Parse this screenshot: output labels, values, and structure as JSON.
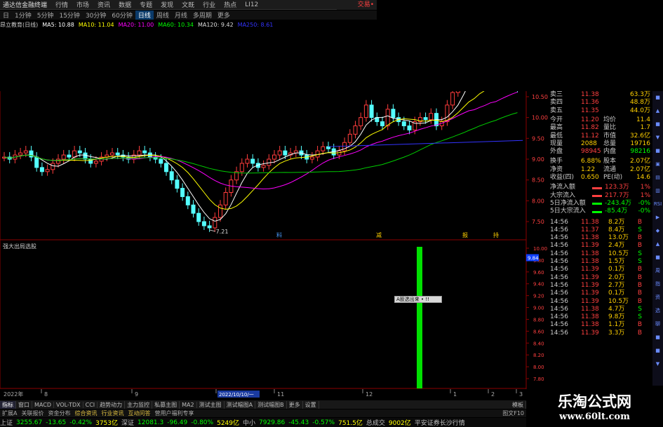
{
  "app": {
    "title": "通达信金融终端",
    "top_right": "交易•"
  },
  "menu": [
    "行情",
    "市场",
    "资讯",
    "数据",
    "专题",
    "发现",
    "文既",
    "行业",
    "热点",
    "LI12"
  ],
  "periods": [
    "日",
    "1分钟",
    "5分钟",
    "15分钟",
    "30分钟",
    "60分钟",
    "日线",
    "周线",
    "月线",
    "多周期",
    "更多"
  ],
  "active_period": "日线",
  "stock_label": "昂立教育(日线)",
  "ma": [
    {
      "label": "MA5: 10.88",
      "color": "#ffffff"
    },
    {
      "label": "MA10: 11.04",
      "color": "#ffff00"
    },
    {
      "label": "MA20: 11.00",
      "color": "#ff00ff"
    },
    {
      "label": "MA60: 10.34",
      "color": "#00ff00"
    },
    {
      "label": "MA120: 9.42",
      "color": "#dddddd"
    },
    {
      "label": "MA250: 8.61",
      "color": "#3333ff"
    }
  ],
  "price_axis": [
    "10.50",
    "10.00",
    "9.50",
    "9.00",
    "8.50",
    "8.00",
    "7.50"
  ],
  "low_label": "7.21",
  "event_marks": [
    {
      "label": "料",
      "color": "#4a9cff"
    },
    {
      "label": "减",
      "color": "#ffd000"
    },
    {
      "label": "报",
      "color": "#ffd000"
    },
    {
      "label": "持",
      "color": "#ffd000"
    }
  ],
  "indicator_title": "强大出局选股",
  "indicator_axis": [
    "10.00",
    "9.80",
    "9.60",
    "9.40",
    "9.20",
    "9.00",
    "8.80",
    "8.60",
    "8.40",
    "8.20",
    "8.00",
    "7.80"
  ],
  "cursor_value": "9.84",
  "tooltip": "A股选出来 • !!",
  "date_axis": [
    "2022年",
    "8",
    "9",
    "10",
    "11",
    "12",
    "1",
    "2",
    "3"
  ],
  "date_highlight": "2022/10/10/一",
  "quote": {
    "ask": [
      {
        "label": "卖三",
        "price": "11.38",
        "vol": "63.3万"
      },
      {
        "label": "卖四",
        "price": "11.36",
        "vol": "48.8万"
      },
      {
        "label": "卖五",
        "price": "11.35",
        "vol": "44.0万"
      }
    ],
    "stats": [
      {
        "l1": "今开",
        "v1": "11.20",
        "c1": "#ff4040",
        "l2": "均价",
        "v2": "11.4"
      },
      {
        "l1": "最高",
        "v1": "11.82",
        "c1": "#ff4040",
        "l2": "量比",
        "v2": "1.7"
      },
      {
        "l1": "最低",
        "v1": "11.12",
        "c1": "#ff4040",
        "l2": "市值",
        "v2": "32.6亿"
      },
      {
        "l1": "现量",
        "v1": "2088",
        "c1": "#ffd000",
        "l2": "总量",
        "v2": "19716"
      },
      {
        "l1": "外盘",
        "v1": "98945",
        "c1": "#ff4040",
        "l2": "内盘",
        "v2": "98216"
      }
    ],
    "stats2": [
      {
        "l1": "换手",
        "v1": "6.88%",
        "l2": "股本",
        "v2": "2.07亿"
      },
      {
        "l1": "净资",
        "v1": "1.22",
        "l2": "流通",
        "v2": "2.07亿"
      },
      {
        "l1": "收益(四)",
        "v1": "0.650",
        "l2": "PE(动)",
        "v2": "14.6"
      }
    ],
    "flows": [
      {
        "label": "净流入额",
        "value": "123.3万",
        "pct": "1%",
        "color": "#ff4040"
      },
      {
        "label": "大宗流入",
        "value": "217.7万",
        "pct": "1%",
        "color": "#ff4040"
      },
      {
        "label": "5日净流入额",
        "value": "-243.4万",
        "pct": "-0%",
        "color": "#00ff00"
      },
      {
        "label": "5日大宗流入",
        "value": "-85.4万",
        "pct": "-0%",
        "color": "#00ff00"
      }
    ],
    "ticks": [
      {
        "t": "14:56",
        "p": "11.38",
        "v": "8.2万",
        "bs": "B"
      },
      {
        "t": "14:56",
        "p": "11.37",
        "v": "8.4万",
        "bs": "S"
      },
      {
        "t": "14:56",
        "p": "11.38",
        "v": "13.0万",
        "bs": "B"
      },
      {
        "t": "14:56",
        "p": "11.39",
        "v": "2.4万",
        "bs": "B"
      },
      {
        "t": "14:56",
        "p": "11.38",
        "v": "10.5万",
        "bs": "S"
      },
      {
        "t": "14:56",
        "p": "11.38",
        "v": "1.5万",
        "bs": "S"
      },
      {
        "t": "14:56",
        "p": "11.39",
        "v": "0.1万",
        "bs": "B"
      },
      {
        "t": "14:56",
        "p": "11.39",
        "v": "2.0万",
        "bs": "B"
      },
      {
        "t": "14:56",
        "p": "11.39",
        "v": "2.7万",
        "bs": "B"
      },
      {
        "t": "14:56",
        "p": "11.39",
        "v": "0.1万",
        "bs": "B"
      },
      {
        "t": "14:56",
        "p": "11.39",
        "v": "10.5万",
        "bs": "B"
      },
      {
        "t": "14:56",
        "p": "11.38",
        "v": "4.7万",
        "bs": "S"
      },
      {
        "t": "14:56",
        "p": "11.38",
        "v": "9.8万",
        "bs": "S"
      },
      {
        "t": "14:56",
        "p": "11.38",
        "v": "1.1万",
        "bs": "B"
      },
      {
        "t": "14:56",
        "p": "11.39",
        "v": "3.3万",
        "bs": "B"
      }
    ]
  },
  "bottom_tabs": [
    "指标",
    "窗口",
    "MACD",
    "VOL-TDX",
    "CCI",
    "趋势动力",
    "主力监控",
    "私募主图",
    "MA2",
    "测试主图",
    "测试幅图A",
    "测试幅图B",
    "更多",
    "设置"
  ],
  "bottom_right_tab": "模板",
  "fig_label": "图文F10",
  "sub_tabs": [
    "扩展A",
    "关联报价",
    "资金分布",
    "综合资讯",
    "行业资讯",
    "互动问答",
    "营用户福利专享"
  ],
  "status": [
    {
      "t": "上证",
      "c": "#c0c0c0"
    },
    {
      "t": "3255.67",
      "c": "#00ff00"
    },
    {
      "t": "-13.65",
      "c": "#00ff00"
    },
    {
      "t": "-0.42%",
      "c": "#00ff00"
    },
    {
      "t": "3753亿",
      "c": "#ffff00"
    },
    {
      "t": "深证",
      "c": "#c0c0c0"
    },
    {
      "t": "12081.3",
      "c": "#00ff00"
    },
    {
      "t": "-96.49",
      "c": "#00ff00"
    },
    {
      "t": "-0.80%",
      "c": "#00ff00"
    },
    {
      "t": "5249亿",
      "c": "#ffff00"
    },
    {
      "t": "中小",
      "c": "#c0c0c0"
    },
    {
      "t": "7929.86",
      "c": "#00ff00"
    },
    {
      "t": "-45.43",
      "c": "#00ff00"
    },
    {
      "t": "-0.57%",
      "c": "#00ff00"
    },
    {
      "t": "751.5亿",
      "c": "#ffff00"
    },
    {
      "t": "总成交",
      "c": "#c0c0c0"
    },
    {
      "t": "9002亿",
      "c": "#ffff00"
    },
    {
      "t": "平安证券长沙行情",
      "c": "#c0c0c0"
    }
  ],
  "ad": {
    "cn": "乐淘公式网",
    "url": "www.60lt.com"
  },
  "scroll_icons": [
    "■",
    "▲",
    "■",
    "▼",
    "■",
    "▣",
    "▤",
    "▥",
    "RSI",
    "▶",
    "◆",
    "▲",
    "■",
    "周",
    "指",
    "资",
    "选",
    "聊",
    "■",
    "■",
    "▼"
  ]
}
